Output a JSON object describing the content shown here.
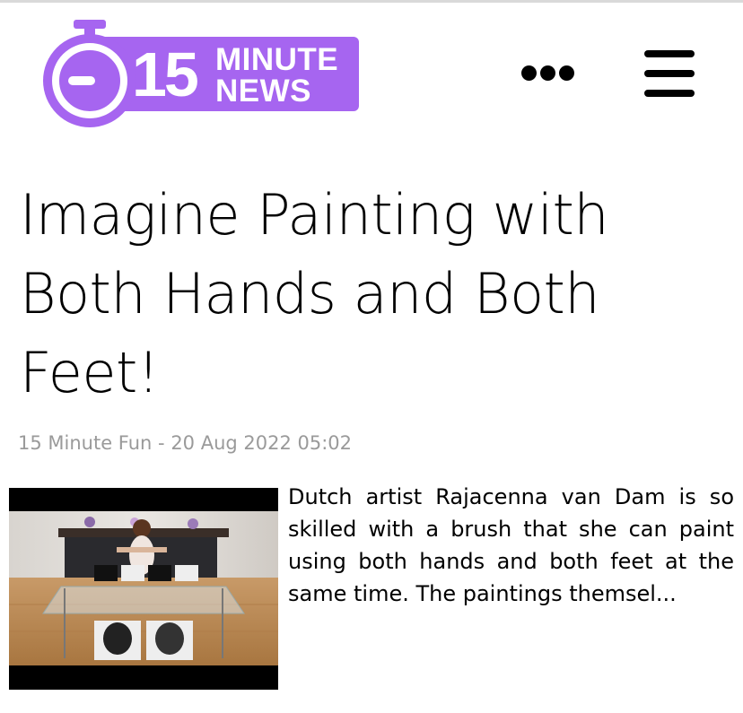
{
  "brand": {
    "number": "15",
    "word1": "MINUTE",
    "word2": "NEWS",
    "color": "#a665f0"
  },
  "header": {
    "more_icon": "more-horizontal-icon",
    "menu_icon": "hamburger-menu-icon"
  },
  "article": {
    "title": "Imagine Painting with Both Hands and Both Feet!",
    "category": "15 Minute Fun",
    "date": "20 Aug 2022 05:02",
    "excerpt": "Dutch artist Rajacenna van Dam is so skilled with a brush that she can paint using both hands and both feet at the same time. The paintings themsel..."
  }
}
